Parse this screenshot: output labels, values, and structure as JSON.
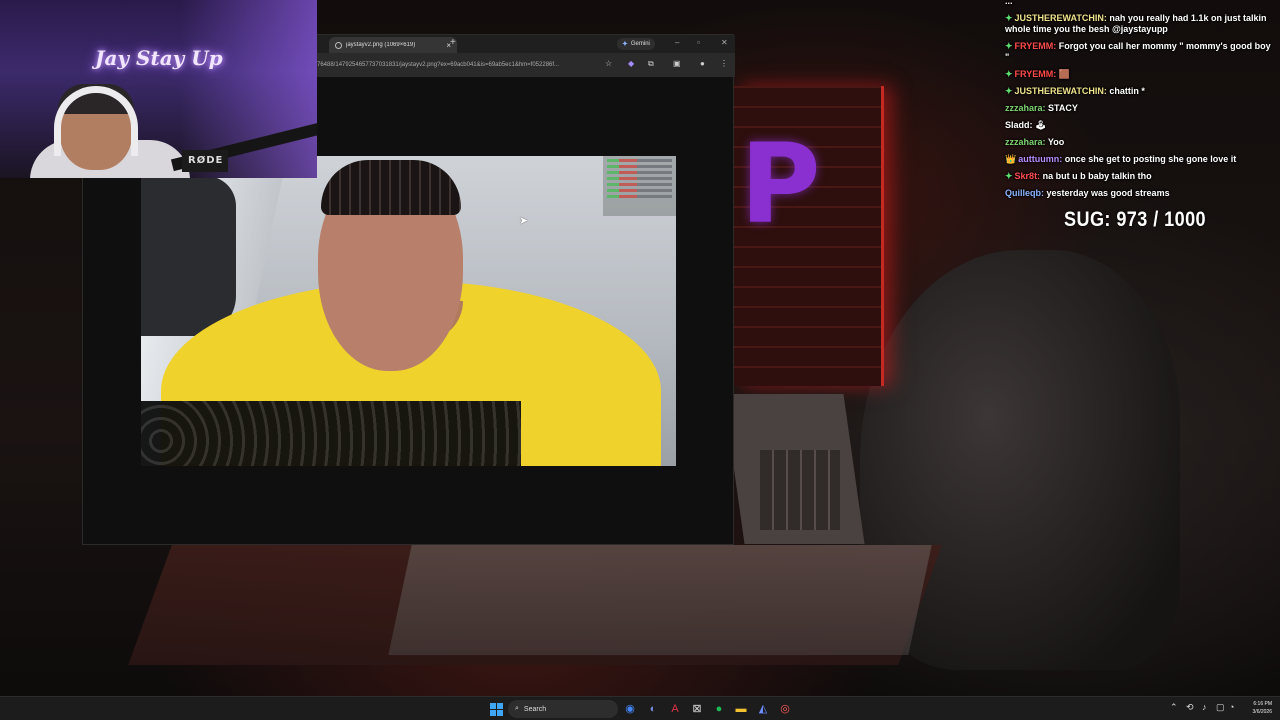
{
  "overlay": {
    "neon_sign": "Jay Stay Up",
    "mic_brand": "RØDE"
  },
  "browser": {
    "tab_title": "jaystayv2.png (1069×619)",
    "tab_close": "×",
    "new_tab": "+",
    "gemini_label": "Gemini",
    "url": "76488/1479254657737031831/jaystayv2.png?ex=69acb041&is=69ab5ec1&hm=f052286f..."
  },
  "chat": {
    "messages": [
      {
        "user": "",
        "text": "...",
        "color": "#ffffff",
        "badge": ""
      },
      {
        "user": "JUSTHEREWATCHIN:",
        "text": "nah you really had 1.1k on just talkin whole time you the besh @jaystayupp",
        "color": "#f0e28a",
        "badge": "✦"
      },
      {
        "user": "FRYEMM:",
        "text": "Forgot you call her mommy \" mommy's good boy \"",
        "color": "#ff4a4a",
        "badge": "✦"
      },
      {
        "user": "FRYEMM:",
        "text": "🟫",
        "color": "#ff4a4a",
        "badge": "✦"
      },
      {
        "user": "JUSTHEREWATCHIN:",
        "text": "chattin *",
        "color": "#f0e28a",
        "badge": "✦"
      },
      {
        "user": "zzzahara:",
        "text": "STACY",
        "color": "#7dd36f",
        "badge": ""
      },
      {
        "user": "Sladd:",
        "text": "🕹",
        "color": "#ffffff",
        "badge": ""
      },
      {
        "user": "zzzahara:",
        "text": "Yoo",
        "color": "#7dd36f",
        "badge": ""
      },
      {
        "user": "auttuumn:",
        "text": "once she get to posting she gone love it",
        "color": "#b78cff",
        "badge": "👑"
      },
      {
        "user": "Skr8t:",
        "text": "na but u b baby talkin tho",
        "color": "#ff4a4a",
        "badge": "✦"
      },
      {
        "user": "Quilleqb:",
        "text": "yesterday was good streams",
        "color": "#8ab4ff",
        "badge": ""
      }
    ]
  },
  "goal": {
    "label": "SUG:",
    "current": "973",
    "separator": "/",
    "target": "1000"
  },
  "taskbar": {
    "search_placeholder": "Search",
    "time": "6:16 PM",
    "date": "3/6/2026"
  },
  "accent_colors": {
    "chat_badge_green": "#5fe06f",
    "windows_blue": "#3ea6f5",
    "shirt_yellow": "#efd22c"
  }
}
